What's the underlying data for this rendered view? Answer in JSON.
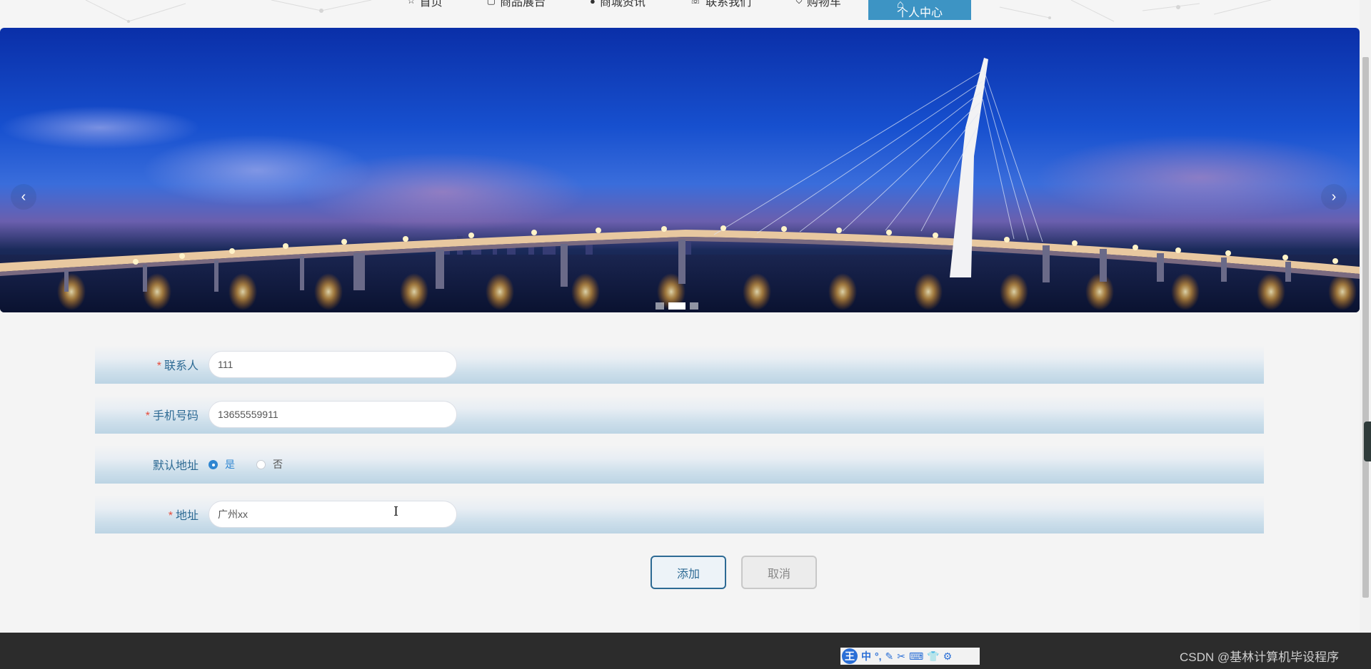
{
  "nav": {
    "items": [
      {
        "icon": "☆",
        "label": "首页"
      },
      {
        "icon": "▢",
        "label": "商品展台"
      },
      {
        "icon": "●",
        "label": "商城资讯"
      },
      {
        "icon": "☏",
        "label": "联系我们"
      },
      {
        "icon": "⛉",
        "label": "购物车"
      }
    ],
    "active": {
      "icon": "⌂",
      "label": "个人中心"
    }
  },
  "carousel": {
    "prev": "‹",
    "next": "›",
    "active_index": 2,
    "count": 3
  },
  "form": {
    "contact": {
      "label": "联系人",
      "value": "111",
      "required": "*"
    },
    "phone": {
      "label": "手机号码",
      "value": "13655559911",
      "required": "*"
    },
    "default_address": {
      "label": "默认地址",
      "yes": "是",
      "no": "否",
      "selected": "是"
    },
    "address": {
      "label": "地址",
      "value": "广州xx",
      "required": "*"
    }
  },
  "actions": {
    "add": "添加",
    "cancel": "取消"
  },
  "cursor": "I",
  "ime": {
    "logo": "王",
    "items": [
      "中",
      "°,",
      "✎",
      "✂",
      "⌨",
      "👕",
      "⚙"
    ]
  },
  "watermark": "CSDN @基林计算机毕设程序",
  "colors": {
    "accent": "#3d94c4",
    "label": "#2d6a94",
    "required": "#e74c3c",
    "footer": "#2c2c2c"
  }
}
